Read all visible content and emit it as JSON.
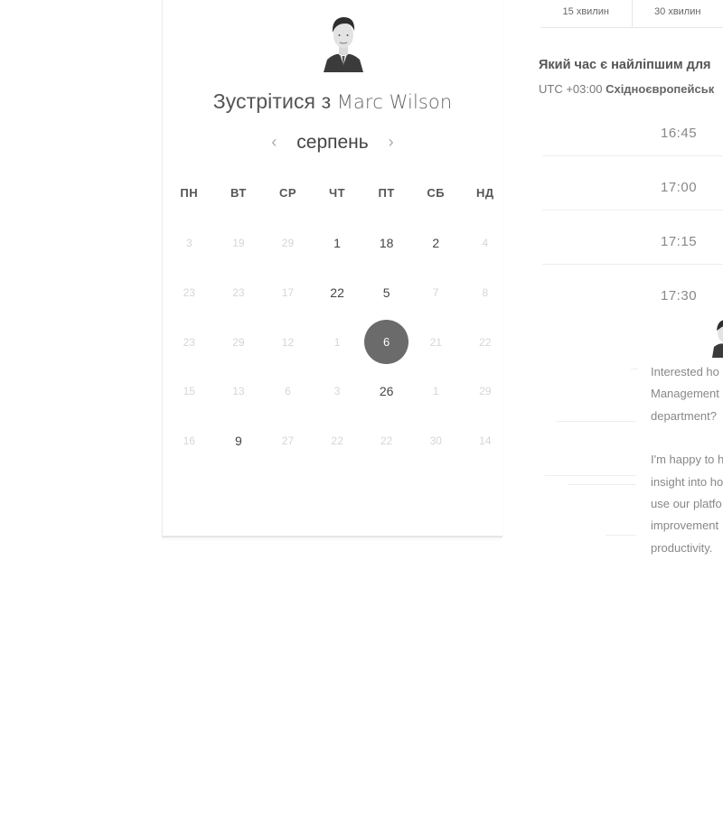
{
  "header": {
    "title_prefix": "Зустрітися з",
    "title_name": "Marc Wilson",
    "month": "серпень",
    "prev_icon": "‹",
    "next_icon": "›"
  },
  "weekdays": [
    "ПН",
    "ВТ",
    "СР",
    "ЧТ",
    "ПТ",
    "СБ",
    "НД"
  ],
  "calendar": {
    "rows": [
      [
        {
          "d": "3",
          "state": "muted"
        },
        {
          "d": "19",
          "state": "muted"
        },
        {
          "d": "29",
          "state": "muted"
        },
        {
          "d": "1",
          "state": "active"
        },
        {
          "d": "18",
          "state": "active"
        },
        {
          "d": "2",
          "state": "active"
        },
        {
          "d": "4",
          "state": "muted"
        }
      ],
      [
        {
          "d": "23",
          "state": "muted"
        },
        {
          "d": "23",
          "state": "muted"
        },
        {
          "d": "17",
          "state": "muted"
        },
        {
          "d": "22",
          "state": "active"
        },
        {
          "d": "5",
          "state": "active"
        },
        {
          "d": "7",
          "state": "muted"
        },
        {
          "d": "8",
          "state": "muted"
        }
      ],
      [
        {
          "d": "23",
          "state": "muted"
        },
        {
          "d": "29",
          "state": "muted"
        },
        {
          "d": "12",
          "state": "muted"
        },
        {
          "d": "1",
          "state": "muted"
        },
        {
          "d": "6",
          "state": "selected"
        },
        {
          "d": "21",
          "state": "muted"
        },
        {
          "d": "22",
          "state": "muted"
        }
      ],
      [
        {
          "d": "15",
          "state": "muted"
        },
        {
          "d": "13",
          "state": "muted"
        },
        {
          "d": "6",
          "state": "muted"
        },
        {
          "d": "3",
          "state": "muted"
        },
        {
          "d": "26",
          "state": "active"
        },
        {
          "d": "1",
          "state": "muted"
        },
        {
          "d": "29",
          "state": "muted"
        }
      ],
      [
        {
          "d": "16",
          "state": "muted"
        },
        {
          "d": "9",
          "state": "active"
        },
        {
          "d": "27",
          "state": "muted"
        },
        {
          "d": "22",
          "state": "muted"
        },
        {
          "d": "22",
          "state": "muted"
        },
        {
          "d": "30",
          "state": "muted"
        },
        {
          "d": "14",
          "state": "muted"
        }
      ]
    ]
  },
  "duration_tabs": [
    "15 хвилин",
    "30 хвилин"
  ],
  "question": "Який час є найліпшим для",
  "timezone": {
    "offset": "UTC +03:00",
    "name": "Східноєвропейськ"
  },
  "slots": [
    "16:45",
    "17:00",
    "17:15",
    "17:30"
  ],
  "message": {
    "p1": [
      "Interested ho",
      "Management",
      "department?"
    ],
    "p2": [
      "I'm happy to h",
      "insight into ho",
      "use our platfo",
      "improvement",
      "productivity."
    ]
  }
}
